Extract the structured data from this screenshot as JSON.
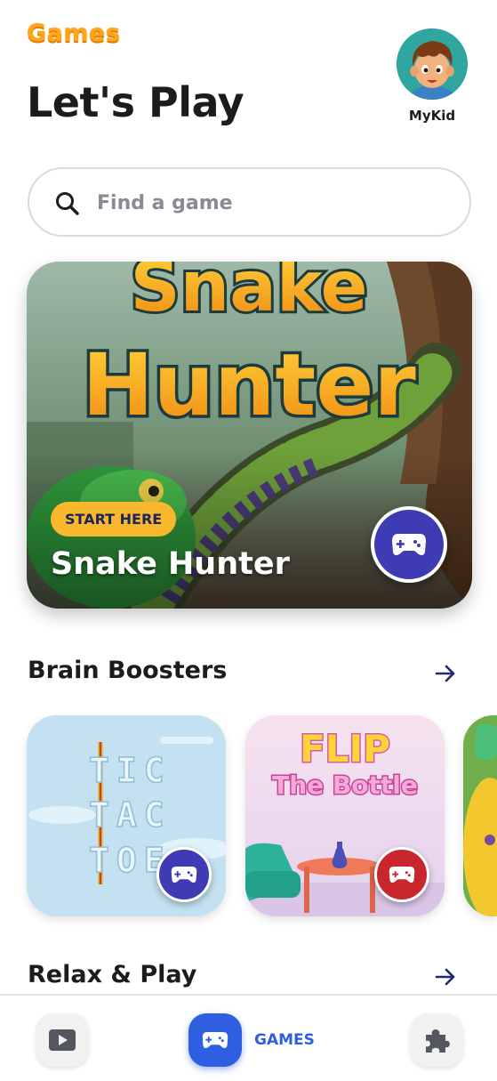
{
  "header": {
    "logo_text": "Games",
    "title": "Let's Play",
    "profile_name": "MyKid"
  },
  "search": {
    "placeholder": "Find a game"
  },
  "featured": {
    "art_title_line1": "Snake",
    "art_title_line2": "Hunter",
    "badge": "START HERE",
    "title": "Snake Hunter"
  },
  "sections": [
    {
      "title": "Brain Boosters",
      "cards": [
        {
          "art_lines": [
            "TIC",
            "TAC",
            "TOE"
          ]
        },
        {
          "art_lines": [
            "FLIP",
            "The Bottle"
          ]
        }
      ]
    },
    {
      "title": "Relax & Play"
    }
  ],
  "bottom_nav": {
    "active_label": "GAMES",
    "items": [
      {
        "icon": "video-icon"
      },
      {
        "icon": "gamepad-icon"
      },
      {
        "icon": "puzzle-icon"
      }
    ]
  },
  "colors": {
    "accent_blue": "#2e5fe0",
    "play_blue": "#3f3bb5",
    "play_red": "#c9262d",
    "badge_yellow": "#f9b82b",
    "logo_orange": "#ffa516"
  }
}
